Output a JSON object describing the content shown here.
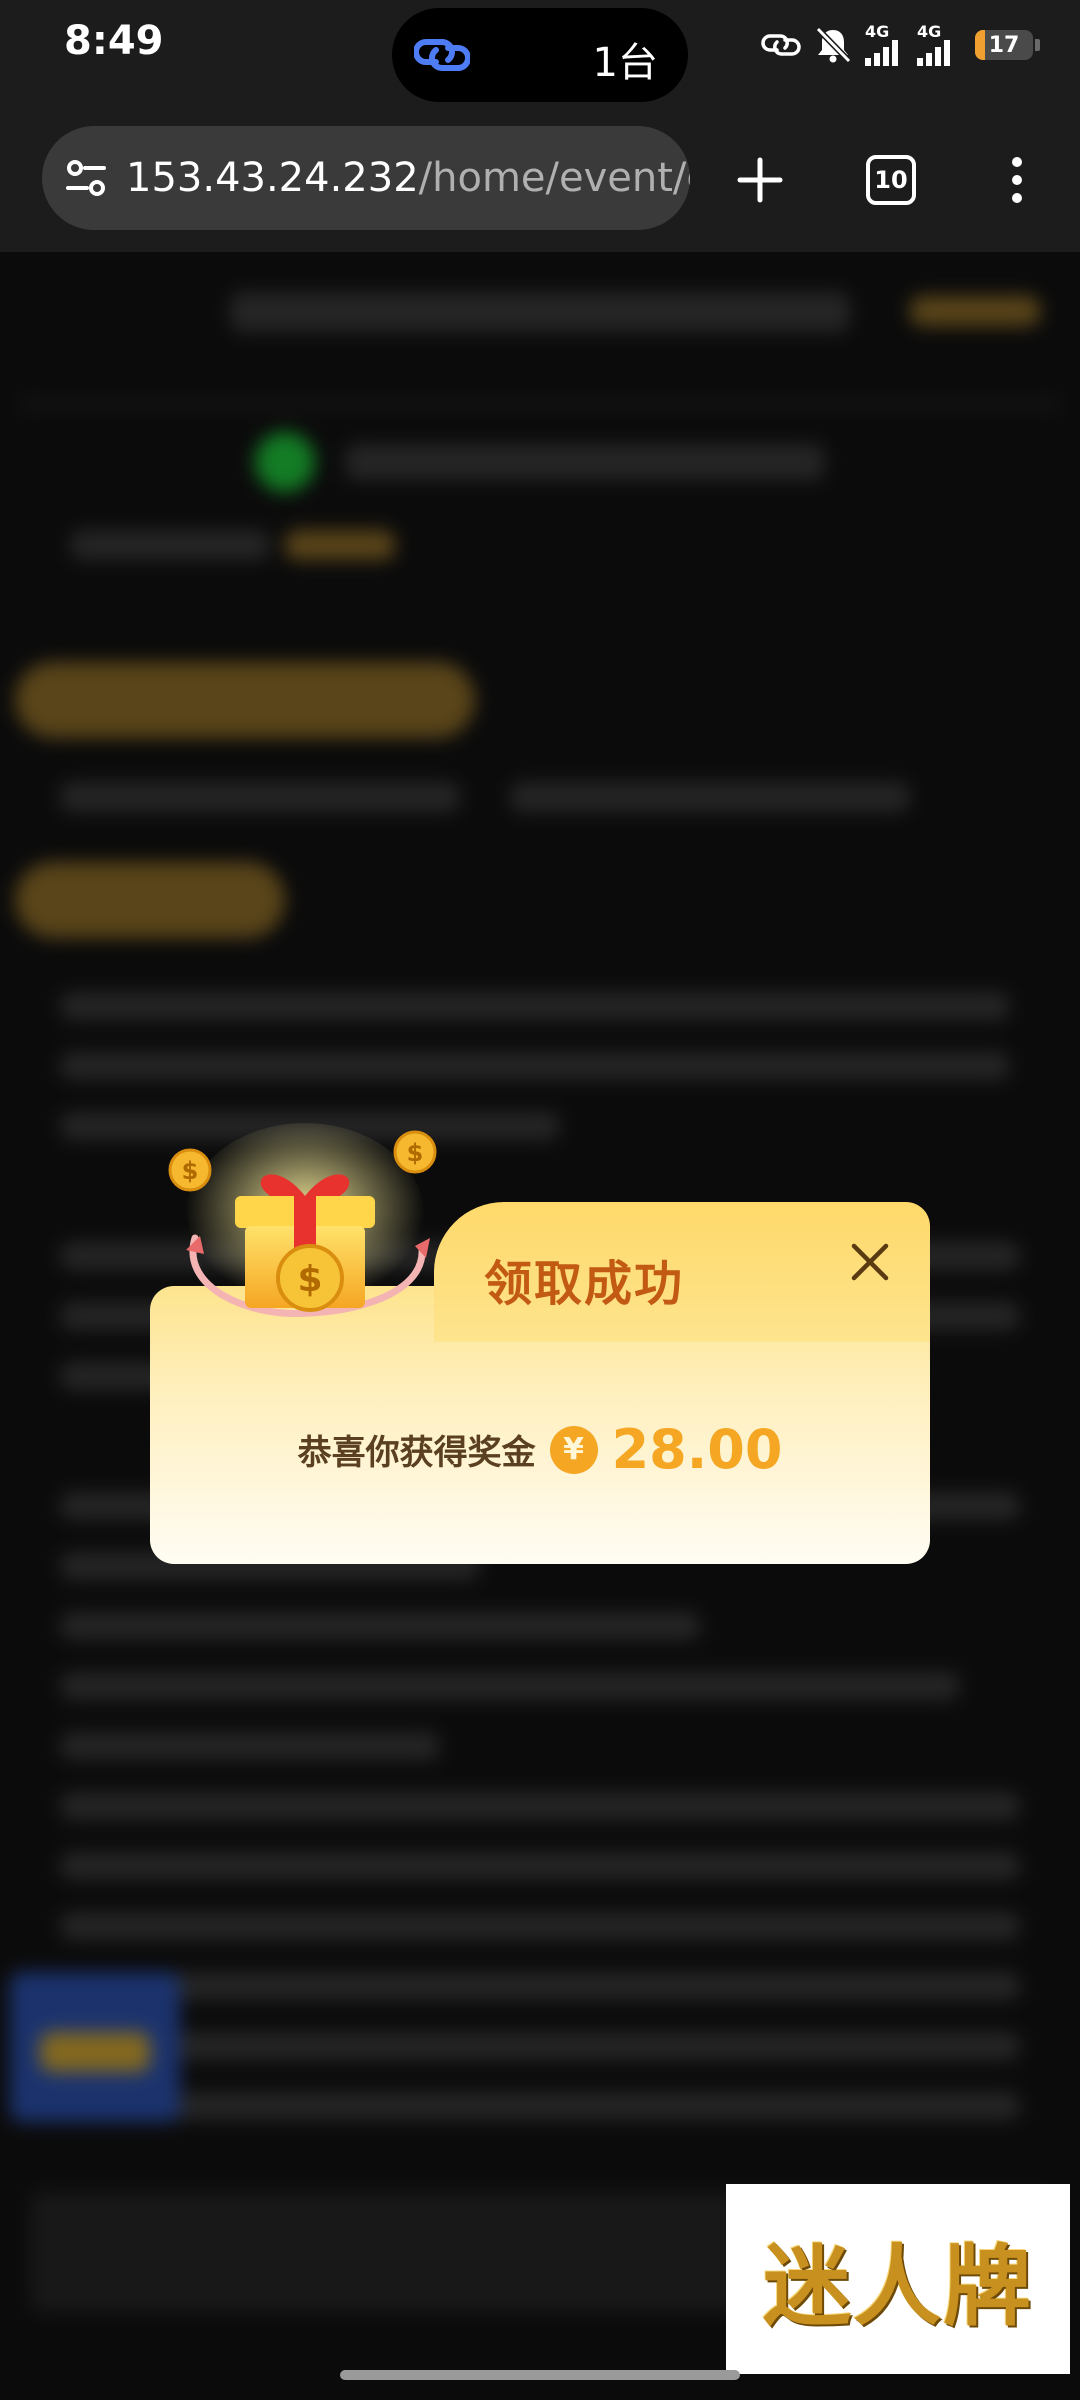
{
  "status_bar": {
    "time": "8:49",
    "island_text": "1台",
    "network_1": "4G",
    "network_2": "4G",
    "battery": "17",
    "battery_level_percent": 17,
    "icons": [
      "link-icon",
      "bell-muted-icon",
      "signal-icon",
      "signal-icon",
      "battery-icon"
    ]
  },
  "browser": {
    "url_host": "153.43.24.232",
    "url_path": "/home/event/de",
    "tab_count": "10",
    "icons": [
      "site-settings-icon",
      "plus-icon",
      "tabs-icon",
      "more-vertical-icon"
    ]
  },
  "modal": {
    "title": "领取成功",
    "reward_label": "恭喜你获得奖金",
    "currency_symbol": "¥",
    "amount": "28.00",
    "icons": [
      "gift-box-icon",
      "close-icon"
    ],
    "colors": {
      "title": "#c25a14",
      "amount": "#f5a623",
      "label": "#5a4020"
    }
  },
  "watermark": {
    "text": "迷人牌"
  }
}
